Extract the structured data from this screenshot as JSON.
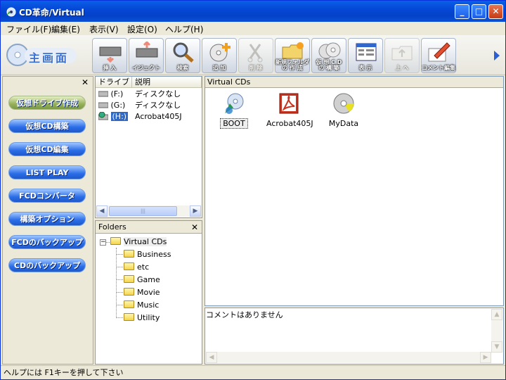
{
  "window": {
    "title": "CD革命/Virtual",
    "min": "_",
    "max": "□",
    "close": "✕"
  },
  "menu": [
    "ファイル(F)",
    "編集(E)",
    "表示(V)",
    "設定(O)",
    "ヘルプ(H)"
  ],
  "logo": {
    "label": "主画面"
  },
  "toolbar": [
    {
      "label": "挿 入",
      "icon": "insert-drive-icon",
      "enabled": true
    },
    {
      "label": "イジェクト",
      "icon": "eject-icon",
      "enabled": true
    },
    {
      "label": "検索",
      "icon": "magnifier-icon",
      "enabled": true
    },
    {
      "label": "追 加",
      "icon": "add-cd-icon",
      "enabled": true
    },
    {
      "label": "削 除",
      "icon": "delete-icon",
      "enabled": false
    },
    {
      "label": "新規フォルダ\nの 作 成",
      "icon": "new-folder-icon",
      "enabled": true
    },
    {
      "label": "仮 想 C D\nの 構 築",
      "icon": "build-cd-icon",
      "enabled": true
    },
    {
      "label": "表 示",
      "icon": "view-icon",
      "enabled": true
    },
    {
      "label": "上 へ",
      "icon": "folder-up-icon",
      "enabled": false
    },
    {
      "label": "コメント編集",
      "icon": "edit-comment-icon",
      "enabled": true
    }
  ],
  "left_panel": {
    "close": "✕",
    "buttons": [
      "仮想ドライブ作成",
      "仮想CD構築",
      "仮想CD編集",
      "LIST PLAY",
      "FCDコンバータ",
      "構築オプション",
      "FCDのバックアップ",
      "CDのバックアップ"
    ]
  },
  "drive_list": {
    "headers": [
      "ドライブ",
      "説明"
    ],
    "rows": [
      {
        "drive": "(F:)",
        "desc": "ディスクなし"
      },
      {
        "drive": "(G:)",
        "desc": "ディスクなし"
      },
      {
        "drive": "(H:)",
        "desc": "Acrobat405J"
      }
    ],
    "scroll_left": "◀",
    "scroll_right": "▶",
    "thumb": "|||"
  },
  "folders": {
    "title": "Folders",
    "close": "✕",
    "root": "Virtual CDs",
    "expander": "−",
    "children": [
      "Business",
      "etc",
      "Game",
      "Movie",
      "Music",
      "Utility"
    ]
  },
  "virtual_cds": {
    "title": "Virtual CDs",
    "items": [
      {
        "label": "BOOT",
        "icon": "boot-cd-icon"
      },
      {
        "label": "Acrobat405J",
        "icon": "acrobat-icon"
      },
      {
        "label": "MyData",
        "icon": "data-cd-icon"
      }
    ]
  },
  "comment": {
    "text": "コメントはありません",
    "scroll_up": "▲",
    "scroll_down": "▼",
    "scroll_left": "◀",
    "scroll_right": "▶"
  },
  "status": {
    "text": "ヘルプには F1キーを押して下さい"
  }
}
